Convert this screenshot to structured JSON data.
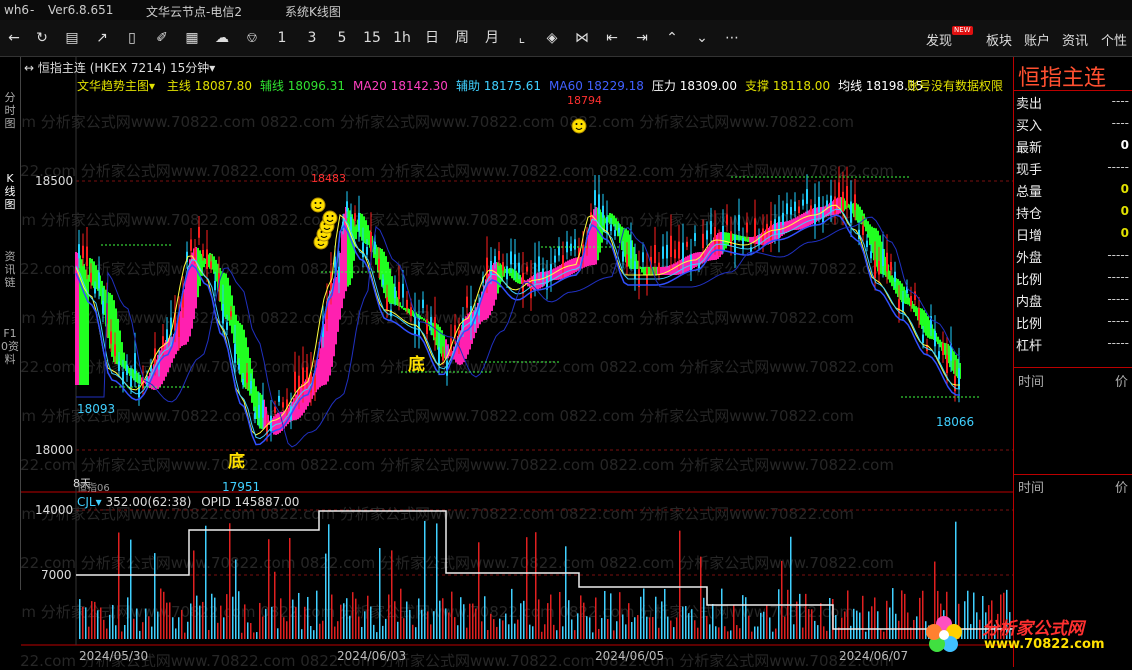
{
  "titlebar": {
    "app": "wh6",
    "dash": "-",
    "version": "Ver6.8.651",
    "server": "文华云节点-电信2",
    "window": "系统K线图"
  },
  "toolbar": {
    "periods": [
      "1",
      "3",
      "5",
      "15",
      "1h",
      "日",
      "周",
      "月"
    ],
    "right": [
      "发现",
      "板块",
      "账户",
      "资讯",
      "个性"
    ],
    "new_badge": "NEW"
  },
  "leftnav": [
    "分时图",
    "K线图",
    "资讯链",
    "F10资料"
  ],
  "instrument": {
    "name": "恒指主连",
    "code": "(HKEX 7214)",
    "period": "15分钟"
  },
  "indicator": {
    "name": "文华趋势主图",
    "items": [
      {
        "label": "主线",
        "value": "18087.80",
        "color": "#e0e000"
      },
      {
        "label": "辅线",
        "value": "18096.31",
        "color": "#30e030"
      },
      {
        "label": "MA20",
        "value": "18142.30",
        "color": "#ff40c0"
      },
      {
        "label": "辅助",
        "value": "18175.61",
        "color": "#40d0ff"
      },
      {
        "label": "MA60",
        "value": "18229.18",
        "color": "#4060ff"
      },
      {
        "label": "压力",
        "value": "18309.00",
        "color": "#ffffff"
      },
      {
        "label": "支撑",
        "value": "18118.00",
        "color": "#e0e000"
      },
      {
        "label": "均线",
        "value": "18198.35",
        "color": "#ffffff"
      }
    ],
    "notice": "账号没有数据权限"
  },
  "price_axis": [
    "18500",
    "18000"
  ],
  "annotations": {
    "low1": "18093",
    "low2": "17951",
    "high1": "18483",
    "high2": "18794",
    "low3": "18066",
    "bottom": "底",
    "bottom2": "底",
    "small": "8天",
    "small2": "恒指06"
  },
  "volume": {
    "name": "CJL",
    "value": "352.00(62:38)",
    "opid": "OPID 145887.00",
    "axis": [
      "14000",
      "7000"
    ]
  },
  "dates": [
    "2024/05/30",
    "2024/06/03",
    "2024/06/05",
    "2024/06/07"
  ],
  "right": {
    "title": "恒指主连",
    "rows": [
      {
        "label": "卖出",
        "value": "----"
      },
      {
        "label": "买入",
        "value": "----"
      },
      {
        "label": "最新",
        "value": "0"
      },
      {
        "label": "现手",
        "value": "-----"
      },
      {
        "label": "总量",
        "value": "0"
      },
      {
        "label": "持仓",
        "value": "0"
      },
      {
        "label": "日增",
        "value": "0"
      },
      {
        "label": "外盘",
        "value": "-----"
      },
      {
        "label": "比例",
        "value": "-----"
      },
      {
        "label": "内盘",
        "value": "-----"
      },
      {
        "label": "比例",
        "value": "-----"
      },
      {
        "label": "杠杆",
        "value": "-----"
      }
    ],
    "time_header": "时间",
    "price_header": "价"
  },
  "watermark": "0822.com 分析家公式网www.70822.com",
  "logo": {
    "line1": "分析家公式网",
    "line2": "www.70822.com"
  }
}
